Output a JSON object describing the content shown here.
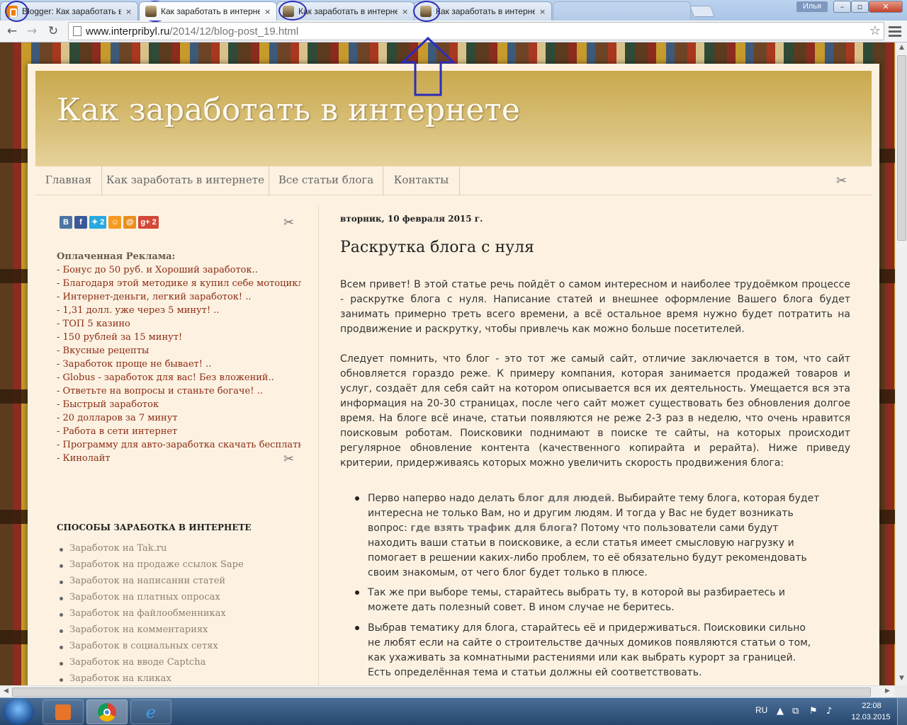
{
  "browser": {
    "tabs": [
      {
        "title": "Blogger: Как заработать в интернете",
        "close": "×",
        "favicon": "blogger-icon"
      },
      {
        "title": "Как заработать в интернете",
        "close": "×",
        "favicon": "site-icon"
      },
      {
        "title": "Как заработать в интернете",
        "close": "×",
        "favicon": "site-icon"
      },
      {
        "title": "Как заработать в интернете",
        "close": "×",
        "favicon": "site-icon"
      }
    ],
    "user": "Илья",
    "url_host": "www.interpribyl.ru",
    "url_path": "/2014/12/blog-post_19.html"
  },
  "blog": {
    "title": "Как заработать в интернете",
    "nav": [
      "Главная",
      "Как заработать в интернете",
      "Все статьи блога",
      "Контакты"
    ]
  },
  "sidebar": {
    "share": [
      {
        "label": "B",
        "color": "#4d75a3"
      },
      {
        "label": "f",
        "color": "#3b5998"
      },
      {
        "label": "2",
        "color": "#29a9e1"
      },
      {
        "label": "",
        "color": "#f59a23"
      },
      {
        "label": "@",
        "color": "#e98f1f"
      },
      {
        "label": "g+ 2",
        "color": "#d34836"
      }
    ],
    "ads_title": "Оплаченная Реклама:",
    "ads": [
      "- Бонус до 50 руб. и Хороший заработок..",
      "- Благодаря этой методике я купил себе мотоцикл..",
      "- Интернет-деньги, легкий заработок! ..",
      "- 1,31 долл. уже через 5 минут! ..",
      "- ТОП 5 казино",
      "- 150 рублей за 15 минут!",
      "- Вкусные рецепты",
      "- Заработок проще не бывает! ..",
      "- Globus - заработок для вас! Без вложений..",
      "- Ответьте на вопросы и станьте богаче! ..",
      "- Быстрый заработок",
      "- 20 долларов за 7 минут",
      "- Работа в сети интернет",
      "- Программу для авто-заработка скачать бесплатн..",
      "- Кинолайт"
    ],
    "ways_title": "СПОСОБЫ ЗАРАБОТКА В ИНТЕРНЕТЕ",
    "ways": [
      "Заработок на Tak.ru",
      "Заработок на продаже ссылок Sape",
      "Заработок на написании статей",
      "Заработок на платных опросах",
      "Заработок на файлообменниках",
      "Заработок на комментариях",
      "Заработок в социальных сетях",
      "Заработок на вводе Captcha",
      "Заработок на кликах"
    ]
  },
  "post": {
    "date": "вторник, 10 февраля 2015 г.",
    "title": "Раскрутка блога с нуля",
    "p1": "Всем привет! В этой статье речь пойдёт о самом интересном и наиболее трудоёмком процессе - раскрутке блога с нуля. Написание статей и внешнее оформление Вашего блога будет занимать примерно треть всего времени, а всё остальное время нужно будет потратить на продвижение и раскрутку, чтобы привлечь как можно больше посетителей.",
    "p2": "Следует помнить, что блог - это тот же самый сайт, отличие заключается в том, что сайт обновляется гораздо реже. К примеру компания, которая занимается продажей товаров и услуг, создаёт для себя сайт на котором описывается вся их деятельность. Умещается вся эта информация на 20-30 страницах, после чего сайт может существовать без обновления долгое время. На блоге всё иначе, статьи появляются не реже 2-3 раз в неделю, что очень нравится поисковым роботам. Поисковики поднимают в поиске те сайты, на которых происходит регулярное обновление контента (качественного копирайта и рерайта). Ниже приведу критерии, придерживаясь которых можно увеличить скорость продвижения блога:",
    "li1_a": "Перво наперво надо делать ",
    "li1_b": "блог для людей",
    "li1_c": ". Выбирайте тему блога, которая будет интересна не только Вам, но и другим людям. И тогда у Вас не будет возникать вопрос: ",
    "li1_d": "где взять трафик для блога",
    "li1_e": "? Потому что пользователи сами будут находить ваши статьи в поисковике, а если статья имеет смысловую нагрузку и помогает в решении каких-либо проблем, то её обязательно будут рекомендовать своим знакомым, от чего блог будет только в плюсе.",
    "li2": "Так же при выборе темы, старайтесь выбрать ту, в которой вы разбираетесь и можете дать полезный совет. В ином случае не беритесь.",
    "li3": "Выбрав тематику для блога, старайтесь её и придерживаться. Поисковики сильно не любят если на сайте о строительстве дачных домиков появляются статьи о том, как ухаживать за комнатными растениями или как выбрать курорт за границей. Есть определённая тема и статьи должны ей соответствовать."
  },
  "taskbar": {
    "lang": "RU",
    "time": "22:08",
    "date": "12.03.2015"
  },
  "colors": {
    "annotation": "#2d2db8",
    "link": "#8b2a12"
  }
}
